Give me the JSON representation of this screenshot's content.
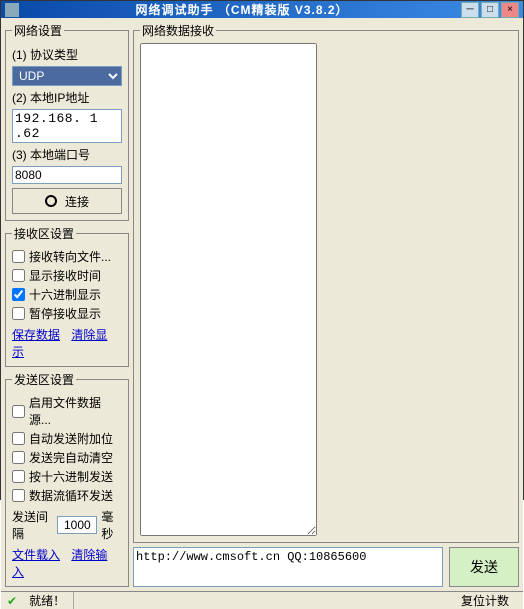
{
  "window": {
    "title": "网络调试助手 （CM精装版 V3.8.2）"
  },
  "network_settings": {
    "legend": "网络设置",
    "protocol_label": "(1) 协议类型",
    "protocol_value": "UDP",
    "local_ip_label": "(2) 本地IP地址",
    "local_ip_value": "192.168. 1 .62",
    "local_port_label": "(3) 本地端口号",
    "local_port_value": "8080",
    "connect_label": "连接"
  },
  "recv_settings": {
    "legend": "接收区设置",
    "opts": [
      {
        "label": "接收转向文件...",
        "checked": false
      },
      {
        "label": "显示接收时间",
        "checked": false
      },
      {
        "label": "十六进制显示",
        "checked": true
      },
      {
        "label": "暂停接收显示",
        "checked": false
      }
    ],
    "save_link": "保存数据",
    "clear_link": "清除显示"
  },
  "send_settings": {
    "legend": "发送区设置",
    "opts": [
      {
        "label": "启用文件数据源...",
        "checked": false
      },
      {
        "label": "自动发送附加位",
        "checked": false
      },
      {
        "label": "发送完自动清空",
        "checked": false
      },
      {
        "label": "按十六进制发送",
        "checked": false
      },
      {
        "label": "数据流循环发送",
        "checked": false
      }
    ],
    "interval_label_prefix": "发送间隔",
    "interval_value": "1000",
    "interval_label_suffix": "毫秒",
    "file_load_link": "文件载入",
    "clear_input_link": "清除输入"
  },
  "recv_panel": {
    "legend": "网络数据接收",
    "content": ""
  },
  "send_panel": {
    "input_value": "http://www.cmsoft.cn QQ:10865600",
    "send_button": "发送"
  },
  "statusbar": {
    "ready": "就绪！",
    "reset": "复位计数"
  }
}
